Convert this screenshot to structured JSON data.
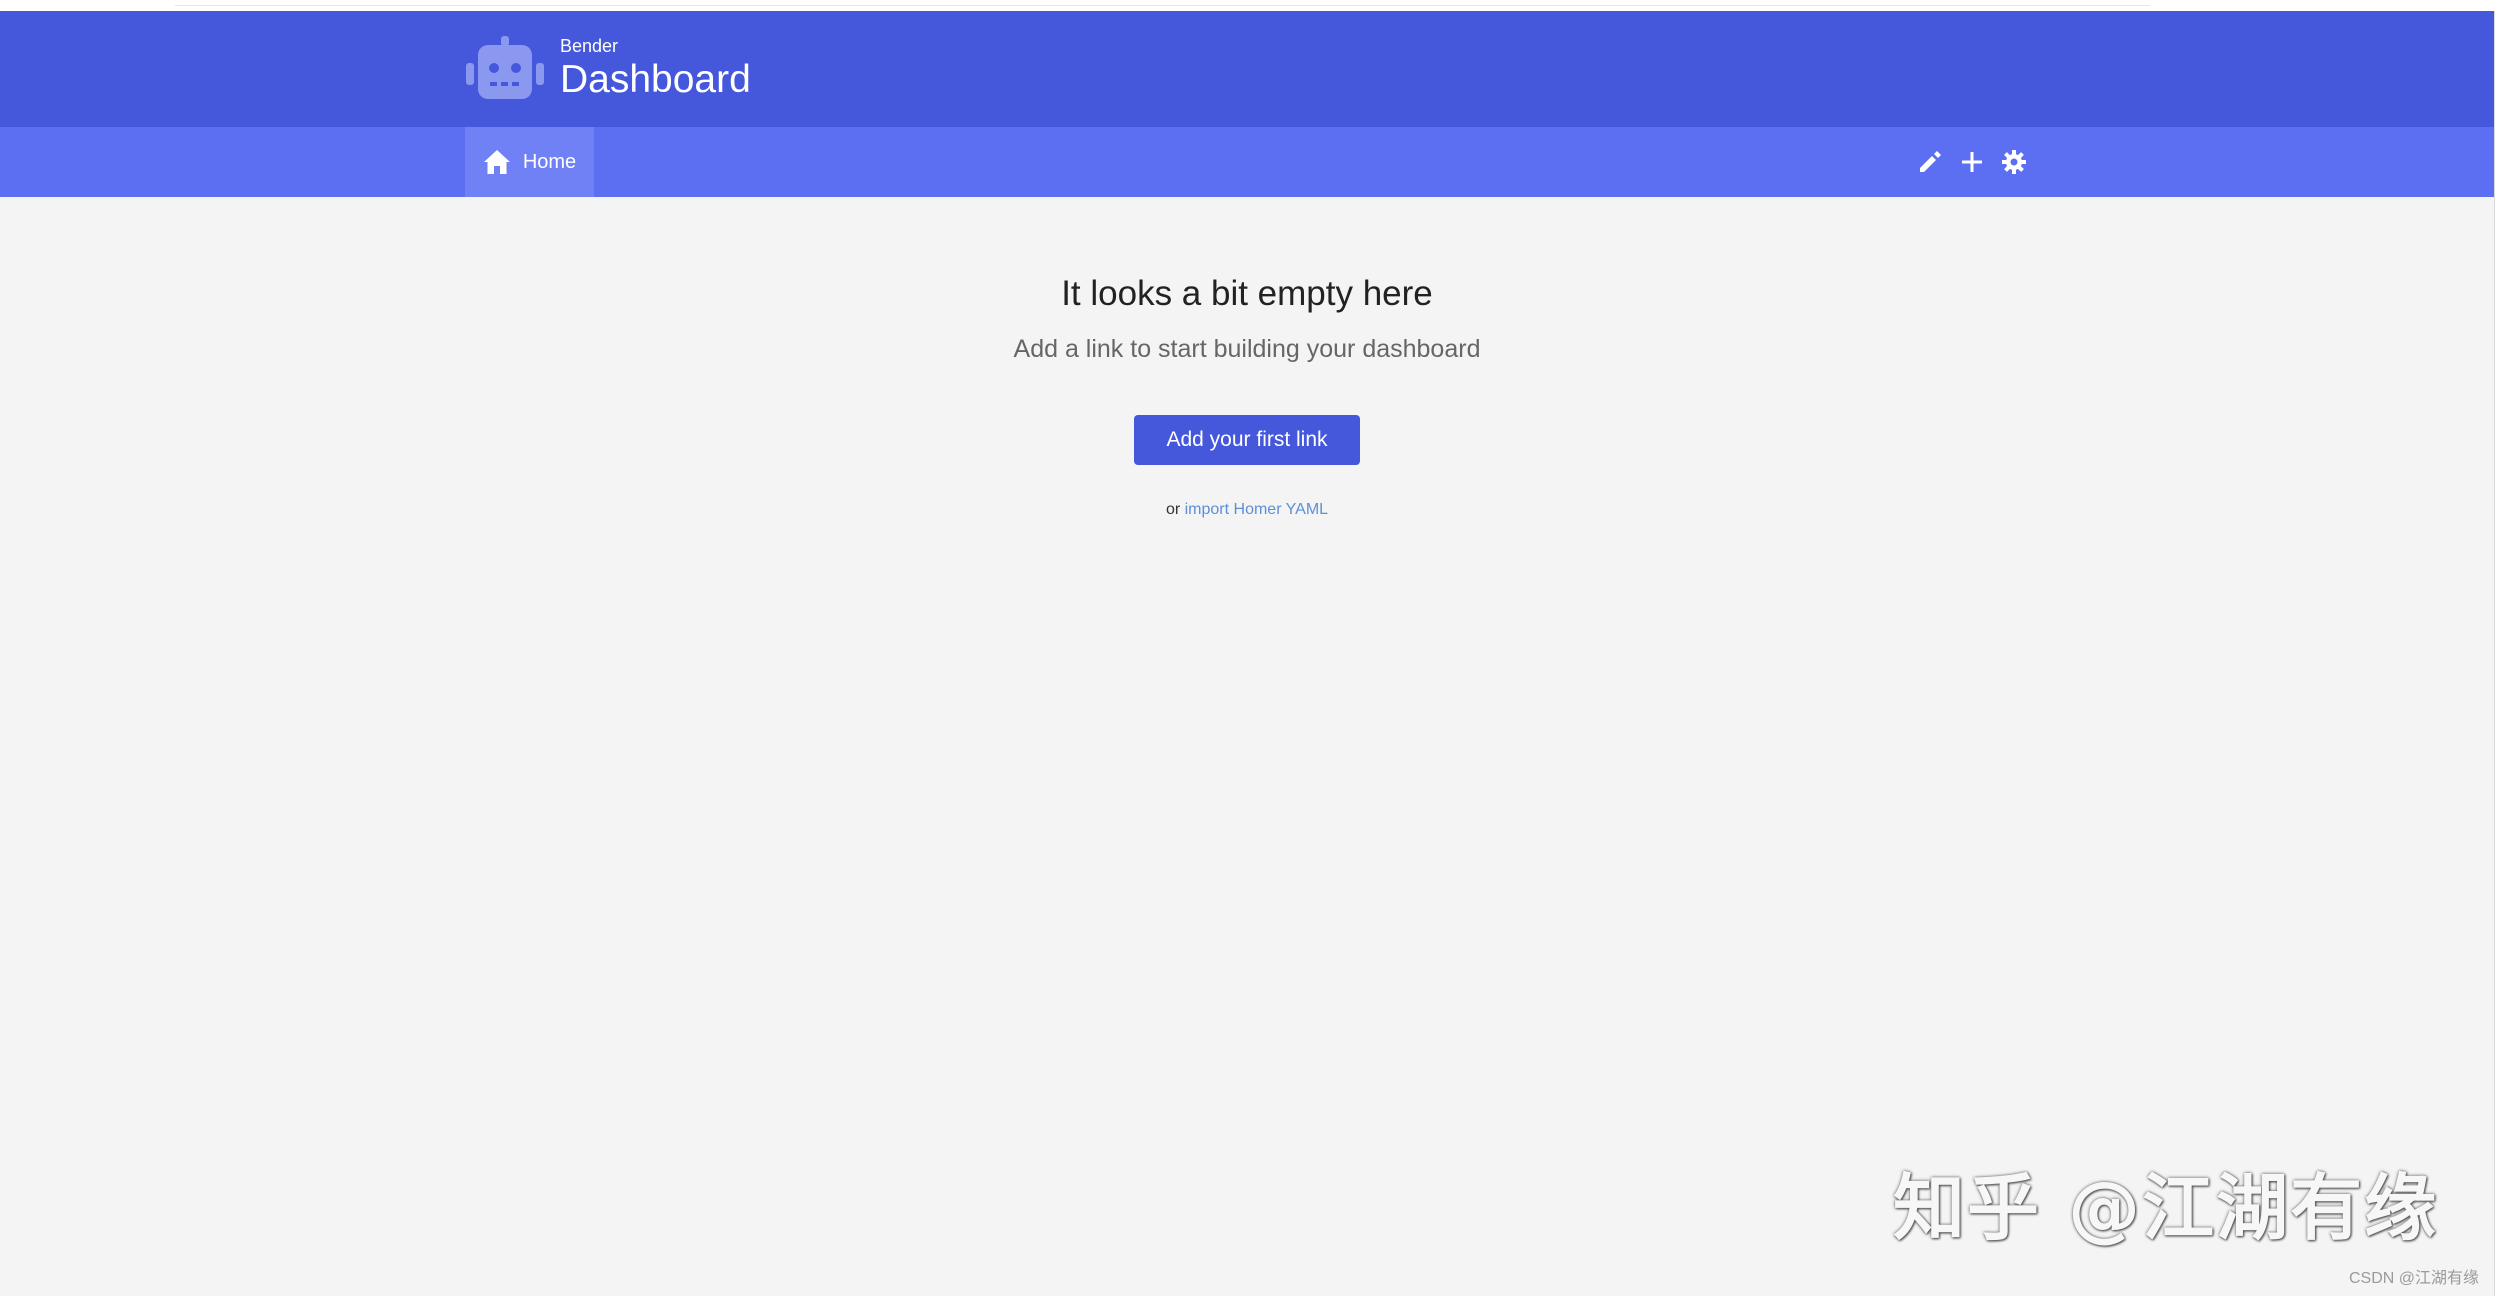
{
  "header": {
    "brand_sub": "Bender",
    "brand_title": "Dashboard",
    "logo_icon": "robot-icon",
    "background": "#4557db"
  },
  "navbar": {
    "home_label": "Home",
    "home_icon": "home-icon",
    "actions": [
      "edit-icon",
      "plus-icon",
      "gear-icon"
    ],
    "background": "#5c6ff2"
  },
  "empty_state": {
    "title": "It looks a bit empty here",
    "subtitle": "Add a link to start building your dashboard",
    "button_label": "Add your first link",
    "import_prefix": "or ",
    "import_link": "import Homer YAML"
  },
  "watermark": {
    "text": "知乎 @江湖有缘",
    "footnote": "CSDN @江湖有缘"
  }
}
